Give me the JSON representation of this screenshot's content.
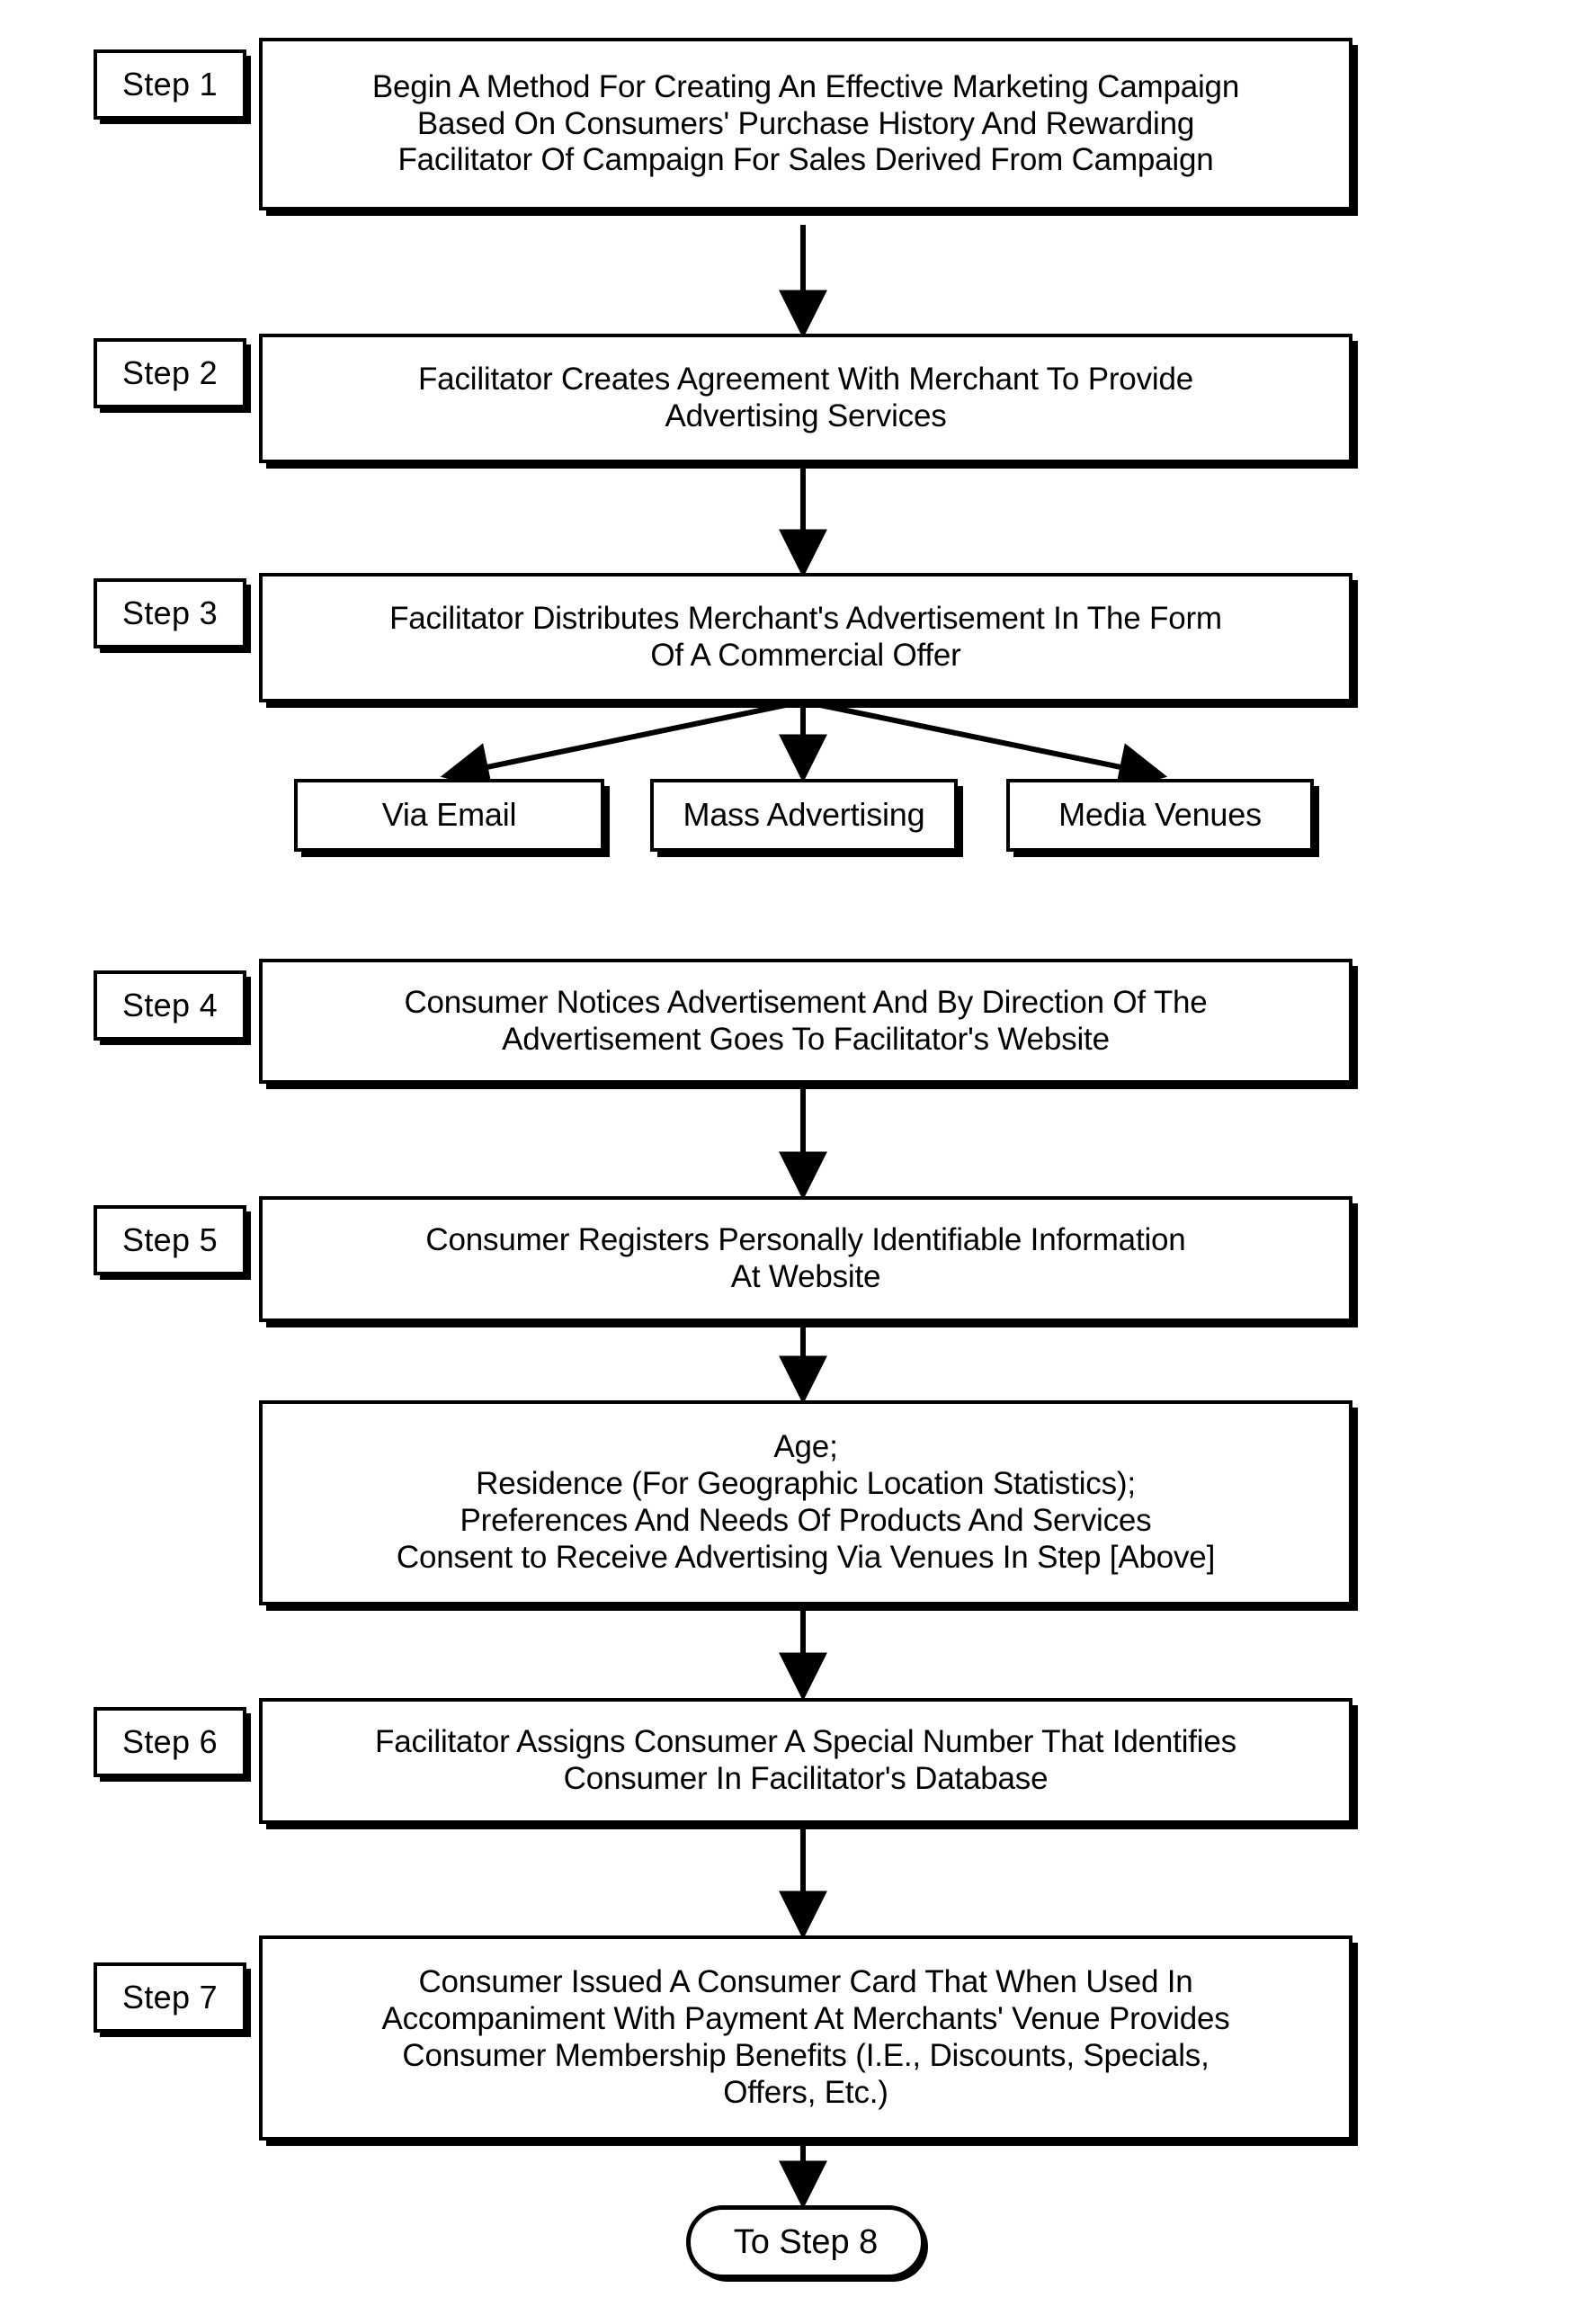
{
  "document": {
    "title": "Method For Creating An Effective Marketing Campaign — Flowchart (Steps 1-7)",
    "background_color": "#ffffff",
    "line_color": "#000000"
  },
  "step_tags": [
    {
      "id": "step-1",
      "label": "Step 1"
    },
    {
      "id": "step-2",
      "label": "Step 2"
    },
    {
      "id": "step-3",
      "label": "Step 3"
    },
    {
      "id": "step-4",
      "label": "Step 4"
    },
    {
      "id": "step-5",
      "label": "Step 5"
    },
    {
      "id": "step-6",
      "label": "Step 6"
    },
    {
      "id": "step-7",
      "label": "Step 7"
    }
  ],
  "nodes": {
    "step1": {
      "text": "Begin A Method For Creating An Effective Marketing Campaign\nBased On Consumers' Purchase History And Rewarding\nFacilitator Of Campaign For Sales Derived From Campaign"
    },
    "step2": {
      "text": "Facilitator Creates Agreement With Merchant To Provide\nAdvertising Services"
    },
    "step3": {
      "text": "Facilitator Distributes Merchant's Advertisement In The Form\nOf A Commercial Offer"
    },
    "branch_via_email": {
      "text": "Via Email"
    },
    "branch_mass_advertising": {
      "text": "Mass Advertising"
    },
    "branch_media_venues": {
      "text": "Media Venues"
    },
    "step4": {
      "text": "Consumer Notices Advertisement And By Direction Of The\nAdvertisement Goes To Facilitator's Website"
    },
    "step5": {
      "text": "Consumer Registers Personally Identifiable Information\nAt Website"
    },
    "registration_details": {
      "text": "Age;\nResidence (For Geographic Location Statistics);\nPreferences And Needs Of Products And Services\nConsent to Receive Advertising Via Venues In Step [Above]"
    },
    "step6": {
      "text": "Facilitator Assigns Consumer A Special Number That Identifies\nConsumer In Facilitator's Database"
    },
    "step7": {
      "text": "Consumer Issued A Consumer Card That When Used In\nAccompaniment With Payment At Merchants' Venue Provides\nConsumer Membership Benefits (I.E., Discounts, Specials,\nOffers, Etc.)"
    },
    "terminal": {
      "text": "To Step 8"
    }
  },
  "chart_data": {
    "type": "diagram",
    "diagram_kind": "flowchart",
    "orientation": "top-to-bottom",
    "title": "Method For Creating An Effective Marketing Campaign",
    "nodes": [
      {
        "id": "step1",
        "tag": "Step 1",
        "shape": "rectangle",
        "label": "Begin A Method For Creating An Effective Marketing Campaign Based On Consumers' Purchase History And Rewarding Facilitator Of Campaign For Sales Derived From Campaign"
      },
      {
        "id": "step2",
        "tag": "Step 2",
        "shape": "rectangle",
        "label": "Facilitator Creates Agreement With Merchant To Provide Advertising Services"
      },
      {
        "id": "step3",
        "tag": "Step 3",
        "shape": "rectangle",
        "label": "Facilitator Distributes Merchant's Advertisement In The Form Of A Commercial Offer"
      },
      {
        "id": "branch_via_email",
        "tag": "",
        "shape": "rectangle",
        "label": "Via Email"
      },
      {
        "id": "branch_mass_advertising",
        "tag": "",
        "shape": "rectangle",
        "label": "Mass Advertising"
      },
      {
        "id": "branch_media_venues",
        "tag": "",
        "shape": "rectangle",
        "label": "Media Venues"
      },
      {
        "id": "step4",
        "tag": "Step 4",
        "shape": "rectangle",
        "label": "Consumer Notices Advertisement And By Direction Of The Advertisement Goes To Facilitator's Website"
      },
      {
        "id": "step5",
        "tag": "Step 5",
        "shape": "rectangle",
        "label": "Consumer Registers Personally Identifiable Information At Website"
      },
      {
        "id": "registration_details",
        "tag": "",
        "shape": "rectangle",
        "label": "Age; Residence (For Geographic Location Statistics); Preferences And Needs Of Products And Services Consent to Receive Advertising Via Venues In Step [Above]"
      },
      {
        "id": "step6",
        "tag": "Step 6",
        "shape": "rectangle",
        "label": "Facilitator Assigns Consumer A Special Number That Identifies Consumer In Facilitator's Database"
      },
      {
        "id": "step7",
        "tag": "Step 7",
        "shape": "rectangle",
        "label": "Consumer Issued A Consumer Card That When Used In Accompaniment With Payment At Merchants' Venue Provides Consumer Membership Benefits (I.E., Discounts, Specials, Offers, Etc.)"
      },
      {
        "id": "terminal",
        "tag": "",
        "shape": "stadium",
        "label": "To Step 8"
      }
    ],
    "edges": [
      {
        "from": "step1",
        "to": "step2",
        "style": "arrow-vertical"
      },
      {
        "from": "step2",
        "to": "step3",
        "style": "arrow-vertical"
      },
      {
        "from": "step3",
        "to": "branch_via_email",
        "style": "arrow-diagonal-left"
      },
      {
        "from": "step3",
        "to": "branch_mass_advertising",
        "style": "arrow-vertical"
      },
      {
        "from": "step3",
        "to": "branch_media_venues",
        "style": "arrow-diagonal-right"
      },
      {
        "from": "step4",
        "to": "step5",
        "style": "arrow-vertical"
      },
      {
        "from": "step5",
        "to": "registration_details",
        "style": "arrow-vertical"
      },
      {
        "from": "registration_details",
        "to": "step6",
        "style": "arrow-vertical"
      },
      {
        "from": "step6",
        "to": "step7",
        "style": "arrow-vertical"
      },
      {
        "from": "step7",
        "to": "terminal",
        "style": "arrow-vertical"
      }
    ]
  }
}
